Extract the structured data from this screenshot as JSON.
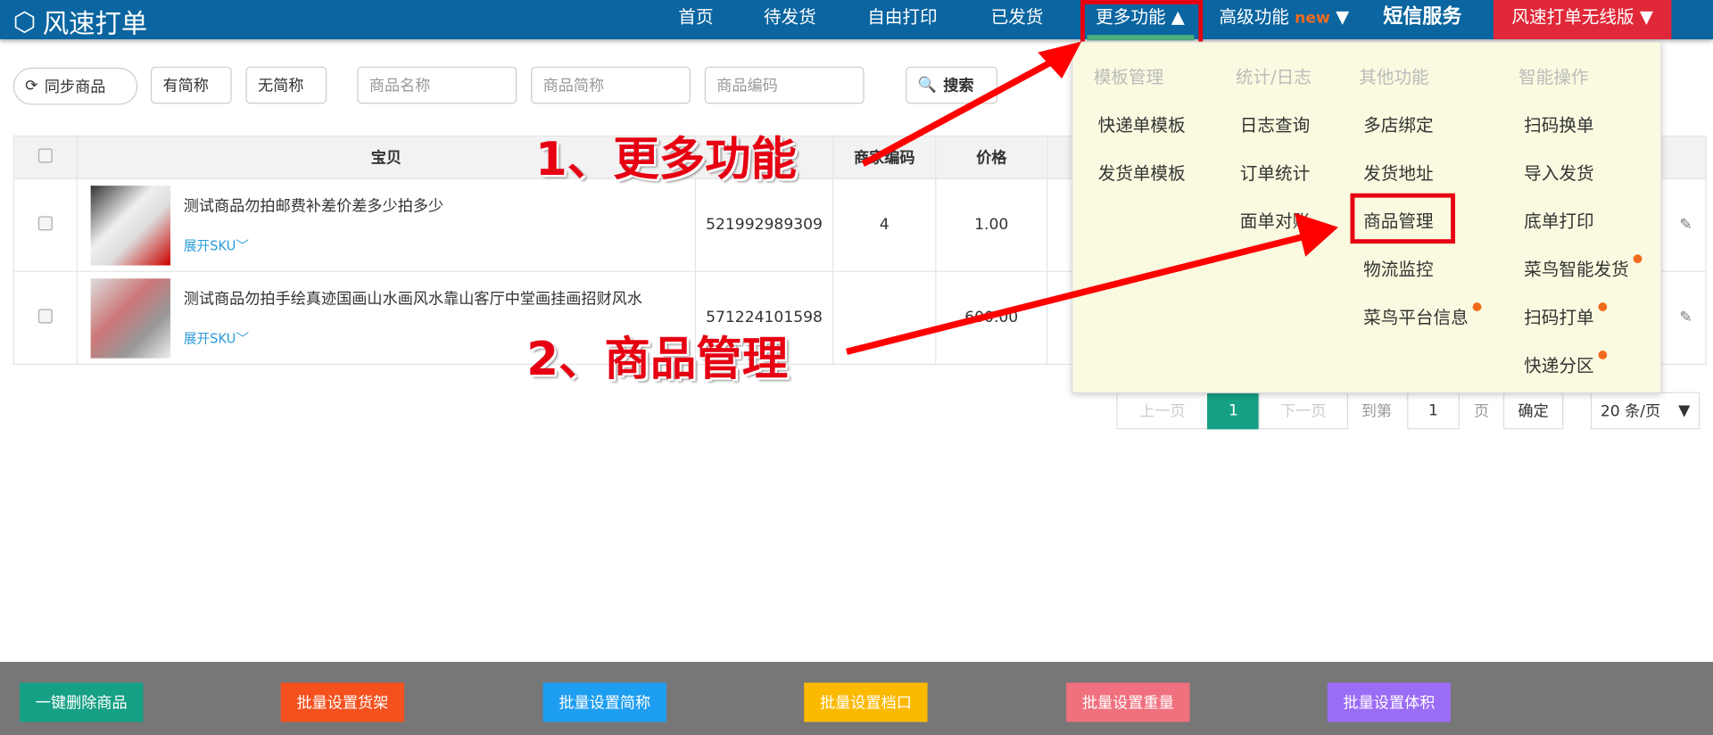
{
  "header": {
    "logo": "风速打单",
    "nav": [
      "首页",
      "待发货",
      "自由打印",
      "已发货",
      "更多功能",
      "高级功能",
      "短信服务"
    ],
    "new_badge": "new",
    "version": "风速打单无线版"
  },
  "toolbar": {
    "sync": "同步商品",
    "has_abbr": "有简称",
    "no_abbr": "无简称",
    "name_ph": "商品名称",
    "abbr_ph": "商品简称",
    "code_ph": "商品编码",
    "search": "搜索"
  },
  "table": {
    "headers": [
      "宝贝",
      "商家编码",
      "价格"
    ],
    "rows": [
      {
        "title": "测试商品勿拍邮费补差价差多少拍多少",
        "sku": "展开SKU",
        "code": "521992989309",
        "merchant_code": "4",
        "price": "1.00"
      },
      {
        "title": "测试商品勿拍手绘真迹国画山水画风水靠山客厅中堂画挂画招财风水",
        "sku": "展开SKU",
        "code": "571224101598",
        "merchant_code": "",
        "price": "600.00"
      }
    ]
  },
  "menu": {
    "col1": {
      "head": "模板管理",
      "items": [
        "快递单模板",
        "发货单模板"
      ]
    },
    "col2": {
      "head": "统计/日志",
      "items": [
        "日志查询",
        "订单统计",
        "面单对账"
      ]
    },
    "col3": {
      "head": "其他功能",
      "items": [
        "多店绑定",
        "发货地址",
        "商品管理",
        "物流监控",
        "菜鸟平台信息"
      ]
    },
    "col4": {
      "head": "智能操作",
      "items": [
        "扫码换单",
        "导入发货",
        "底单打印",
        "菜鸟智能发货",
        "扫码打单",
        "快递分区"
      ]
    }
  },
  "pagination": {
    "prev": "上一页",
    "current": "1",
    "next": "下一页",
    "goto": "到第",
    "page_value": "1",
    "page_unit": "页",
    "confirm": "确定",
    "page_size": "20 条/页"
  },
  "bottom": [
    "一键删除商品",
    "批量设置货架",
    "批量设置简称",
    "批量设置档口",
    "批量设置重量",
    "批量设置体积"
  ],
  "annotations": {
    "step1": "1、更多功能",
    "step2": "2、商品管理"
  }
}
